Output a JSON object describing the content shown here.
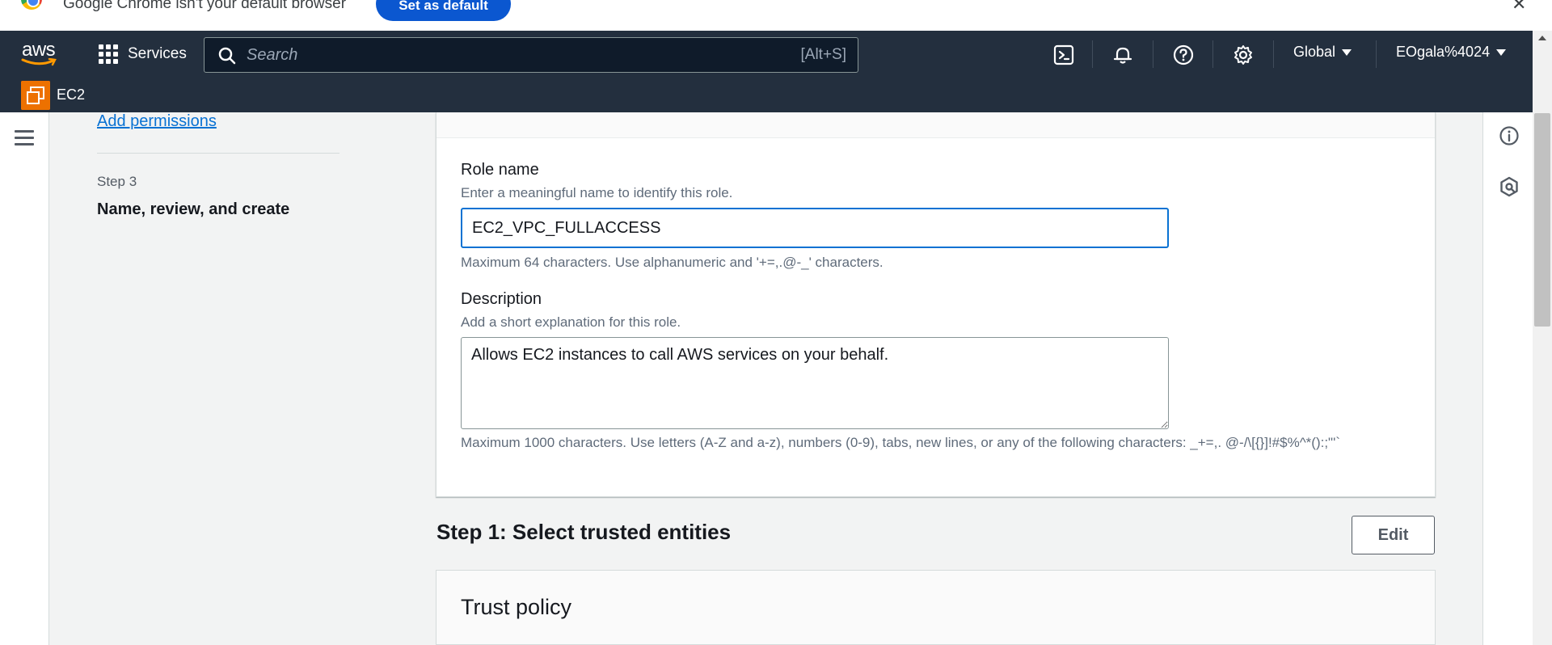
{
  "browser_banner": {
    "message": "Google Chrome isn't your default browser",
    "button_label": "Set as default",
    "close_label": "✕"
  },
  "aws_nav": {
    "logo_text": "aws",
    "services_label": "Services",
    "search_placeholder": "Search",
    "search_shortcut": "[Alt+S]",
    "region_label": "Global",
    "account_label": "EOgala%4024",
    "service_label": "EC2",
    "icons": [
      "cloudshell-icon",
      "notifications-icon",
      "help-icon",
      "settings-icon"
    ]
  },
  "steps": {
    "previous_link": "Add permissions",
    "step_number": "Step 3",
    "step_title": "Name, review, and create"
  },
  "form": {
    "role_name_label": "Role name",
    "role_name_desc": "Enter a meaningful name to identify this role.",
    "role_name_value": "EC2_VPC_FULLACCESS",
    "role_name_constraint": "Maximum 64 characters. Use alphanumeric and '+=,.@-_' characters.",
    "description_label": "Description",
    "description_desc": "Add a short explanation for this role.",
    "description_value": "Allows EC2 instances to call AWS services on your behalf.",
    "description_constraint": "Maximum 1000 characters. Use letters (A-Z and a-z), numbers (0-9), tabs, new lines, or any of the following characters: _+=,. @-/\\[{}]!#$%^*():;\"'`"
  },
  "step1": {
    "title": "Step 1: Select trusted entities",
    "edit_label": "Edit",
    "trust_policy_title": "Trust policy"
  },
  "colors": {
    "nav_bg": "#232f3e",
    "link": "#0972d3",
    "ec2_orange": "#ed7100",
    "chrome_button": "#0b57d0"
  }
}
